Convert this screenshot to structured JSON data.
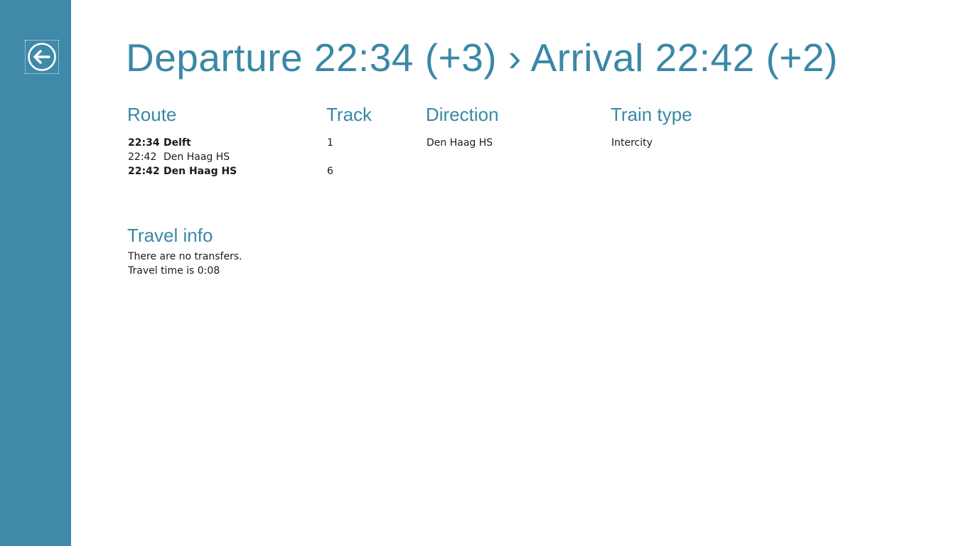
{
  "title": "Departure 22:34 (+3) › Arrival 22:42 (+2)",
  "colors": {
    "sidebar": "#3e8aa8",
    "accent": "#3a88a6",
    "text": "#1a1a1a"
  },
  "back_button": {
    "icon": "arrow-left-circle-icon"
  },
  "columns": {
    "route": "Route",
    "track": "Track",
    "direction": "Direction",
    "train_type": "Train type"
  },
  "route": [
    {
      "time": "22:34",
      "station": "Delft",
      "bold": true,
      "track": "1",
      "direction": "Den Haag HS",
      "train_type": "Intercity"
    },
    {
      "time": "22:42",
      "station": "Den Haag HS",
      "bold": false,
      "track": "",
      "direction": "",
      "train_type": ""
    },
    {
      "time": "22:42",
      "station": "Den Haag HS",
      "bold": true,
      "track": "6",
      "direction": "",
      "train_type": ""
    }
  ],
  "travel_info": {
    "title": "Travel info",
    "lines": [
      "There are no transfers.",
      "Travel time is 0:08"
    ]
  }
}
